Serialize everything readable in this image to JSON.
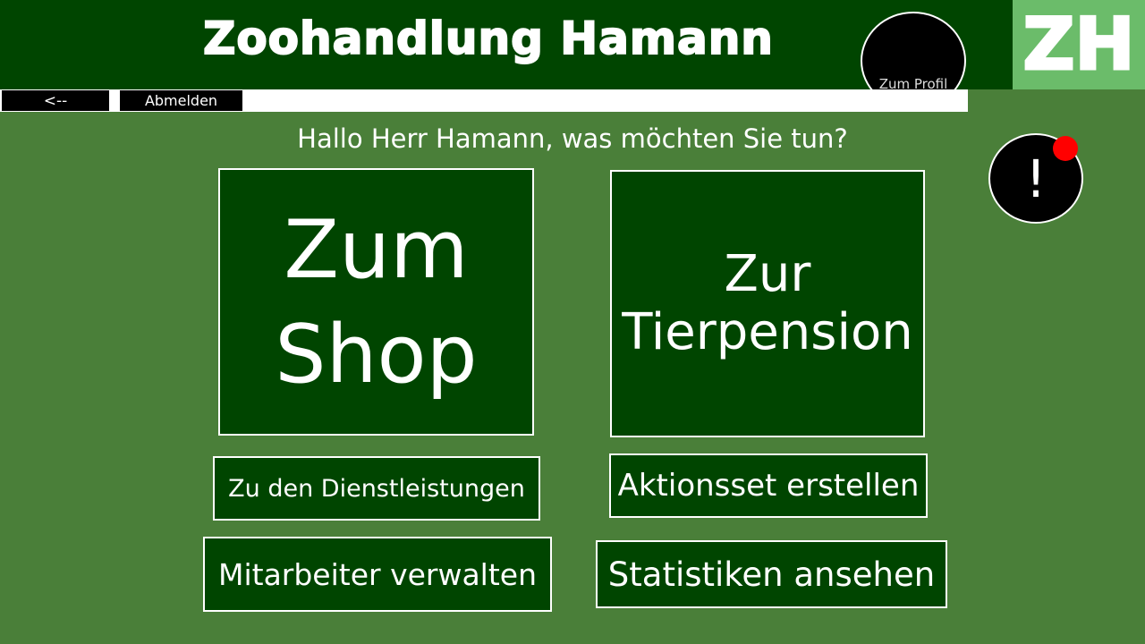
{
  "header": {
    "title": "Zoohandlung Hamann",
    "logo_text": "ZH",
    "profile_label": "Zum Profil"
  },
  "nav": {
    "back_label": "<--",
    "logout_label": "Abmelden"
  },
  "main": {
    "greeting": "Hallo Herr Hamann, was möchten Sie tun?",
    "tiles": {
      "shop_line1": "Zum",
      "shop_line2": "Shop",
      "pension_line1": "Zur",
      "pension_line2": "Tierpension"
    },
    "buttons": {
      "services": "Zu den Dienstleistungen",
      "actionset": "Aktionsset erstellen",
      "staff": "Mitarbeiter verwalten",
      "stats": "Statistiken ansehen"
    }
  },
  "alert": {
    "icon": "exclamation-icon",
    "symbol": "!",
    "badge_color": "#ff0000"
  },
  "colors": {
    "background": "#4a7f39",
    "header": "#004500",
    "logo_bg": "#6bbc6a",
    "tile": "#004500"
  }
}
